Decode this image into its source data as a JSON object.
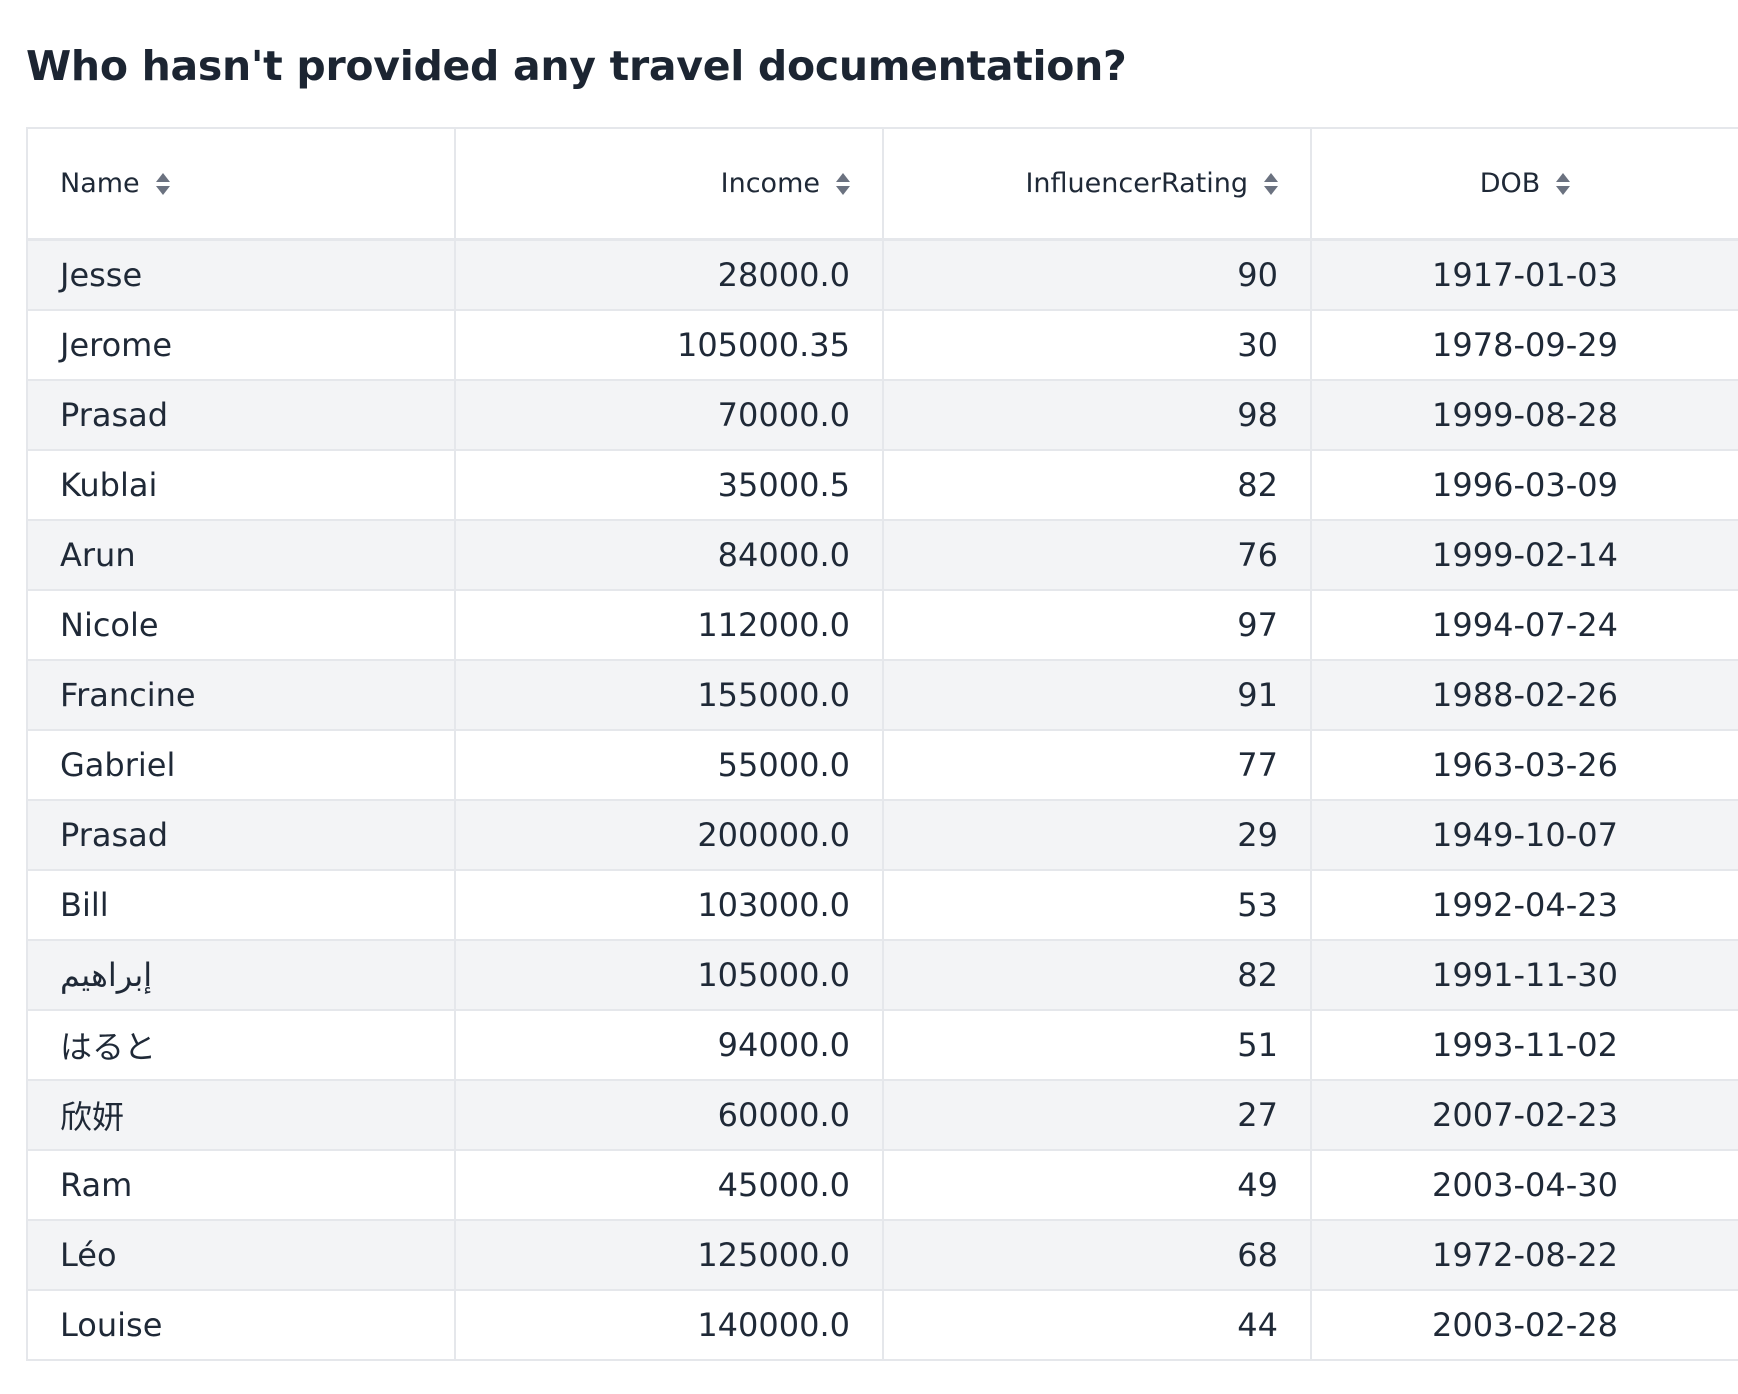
{
  "title": "Who hasn't provided any travel documentation?",
  "table": {
    "columns": [
      {
        "key": "name",
        "label": "Name",
        "sort_icon": "sort-icon"
      },
      {
        "key": "income",
        "label": "Income",
        "sort_icon": "sort-icon"
      },
      {
        "key": "influencer_rating",
        "label": "InfluencerRating",
        "sort_icon": "sort-icon"
      },
      {
        "key": "dob",
        "label": "DOB",
        "sort_icon": "sort-icon"
      }
    ],
    "rows": [
      {
        "name": "Jesse",
        "income": "28000.0",
        "influencer_rating": "90",
        "dob": "1917-01-03"
      },
      {
        "name": "Jerome",
        "income": "105000.35",
        "influencer_rating": "30",
        "dob": "1978-09-29"
      },
      {
        "name": "Prasad",
        "income": "70000.0",
        "influencer_rating": "98",
        "dob": "1999-08-28"
      },
      {
        "name": "Kublai",
        "income": "35000.5",
        "influencer_rating": "82",
        "dob": "1996-03-09"
      },
      {
        "name": "Arun",
        "income": "84000.0",
        "influencer_rating": "76",
        "dob": "1999-02-14"
      },
      {
        "name": "Nicole",
        "income": "112000.0",
        "influencer_rating": "97",
        "dob": "1994-07-24"
      },
      {
        "name": "Francine",
        "income": "155000.0",
        "influencer_rating": "91",
        "dob": "1988-02-26"
      },
      {
        "name": "Gabriel",
        "income": "55000.0",
        "influencer_rating": "77",
        "dob": "1963-03-26"
      },
      {
        "name": "Prasad",
        "income": "200000.0",
        "influencer_rating": "29",
        "dob": "1949-10-07"
      },
      {
        "name": "Bill",
        "income": "103000.0",
        "influencer_rating": "53",
        "dob": "1992-04-23"
      },
      {
        "name": "إبراهيم",
        "income": "105000.0",
        "influencer_rating": "82",
        "dob": "1991-11-30"
      },
      {
        "name": "はると",
        "income": "94000.0",
        "influencer_rating": "51",
        "dob": "1993-11-02"
      },
      {
        "name": "欣妍",
        "income": "60000.0",
        "influencer_rating": "27",
        "dob": "2007-02-23"
      },
      {
        "name": "Ram",
        "income": "45000.0",
        "influencer_rating": "49",
        "dob": "2003-04-30"
      },
      {
        "name": "Léo",
        "income": "125000.0",
        "influencer_rating": "68",
        "dob": "1972-08-22"
      },
      {
        "name": "Louise",
        "income": "140000.0",
        "influencer_rating": "44",
        "dob": "2003-02-28"
      }
    ]
  }
}
